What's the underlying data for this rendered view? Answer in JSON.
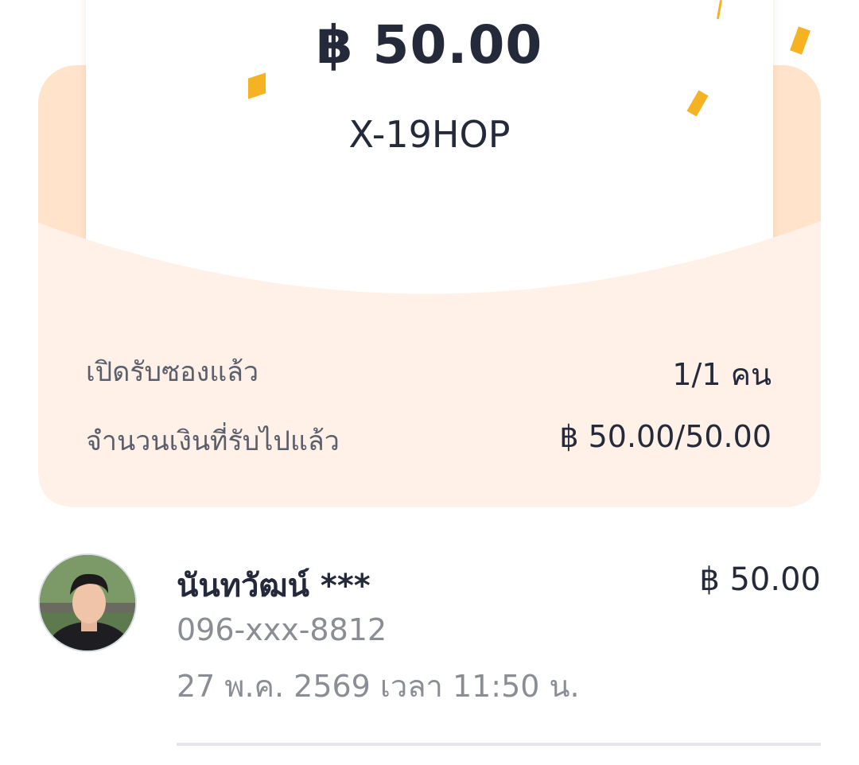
{
  "card": {
    "amount": "฿ 50.00",
    "code": "X-19HOP"
  },
  "stats": [
    {
      "label": "เปิดรับซองแล้ว",
      "value": "1/1 คน"
    },
    {
      "label": "จำนวนเงินที่รับไปแล้ว",
      "value": "฿ 50.00/50.00"
    }
  ],
  "receiver": {
    "name": "นันทวัฒน์ ***",
    "amount": "฿ 50.00",
    "phone": "096-xxx-8812",
    "time": "27 พ.ค. 2569 เวลา 11:50 น."
  },
  "colors": {
    "envelope_back": "#ffe3cb",
    "envelope_front": "#fff1e8",
    "confetti": "#f5b324",
    "text_dark": "#252a3a",
    "text_muted": "#8b8d94"
  },
  "icons": {
    "avatar": "user-photo",
    "confetti": "confetti-pieces"
  }
}
